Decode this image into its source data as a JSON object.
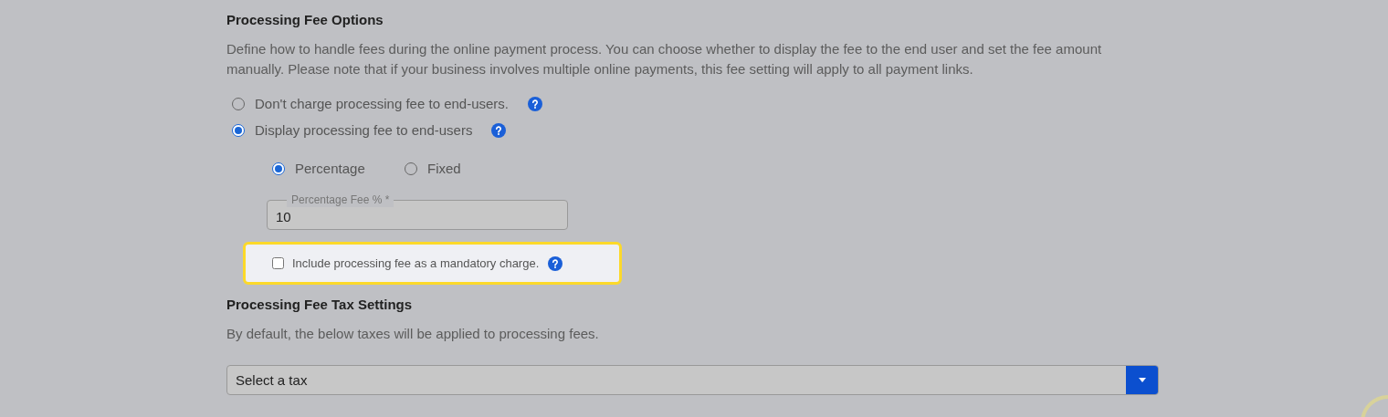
{
  "fee_options": {
    "title": "Processing Fee Options",
    "description": "Define how to handle fees during the online payment process. You can choose whether to display the fee to the end user and set the fee amount manually. Please note that if your business involves multiple online payments, this fee setting will apply to all payment links.",
    "modes": [
      {
        "label": "Don't charge processing fee to end-users.",
        "selected": false
      },
      {
        "label": "Display processing fee to end-users",
        "selected": true
      }
    ],
    "fee_types": [
      {
        "label": "Percentage",
        "selected": true
      },
      {
        "label": "Fixed",
        "selected": false
      }
    ],
    "fee_field": {
      "label": "Percentage Fee % *",
      "value": "10"
    },
    "mandatory": {
      "label": "Include processing fee as a mandatory charge.",
      "checked": false,
      "highlighted": true
    }
  },
  "tax_settings": {
    "title": "Processing Fee Tax Settings",
    "description": "By default, the below taxes will be applied to processing fees.",
    "select": {
      "placeholder": "Select a tax"
    }
  }
}
